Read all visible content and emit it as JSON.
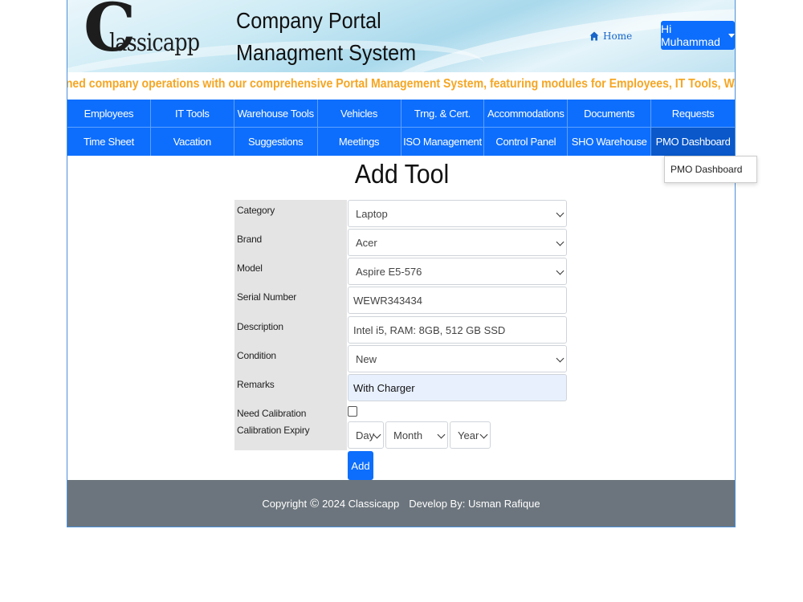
{
  "header": {
    "logo_initial": "C",
    "logo_rest": "lassicapp",
    "title_line1": "Company Portal",
    "title_line2": "Managment System",
    "home_label": "Home",
    "user_label": "Hi Muhammad"
  },
  "marquee": {
    "text": "lined company operations with our comprehensive Portal Management System, featuring modules for Employees, IT Tools, Warehouse Inventory, Vehi"
  },
  "nav": {
    "row1": [
      "Employees",
      "IT Tools",
      "Warehouse Tools",
      "Vehicles",
      "Trng. & Cert.",
      "Accommodations",
      "Documents",
      "Requests"
    ],
    "row2": [
      "Time Sheet",
      "Vacation",
      "Suggestions",
      "Meetings",
      "ISO Management",
      "Control Panel",
      "SHO Warehouse",
      "PMO Dashboard"
    ],
    "dropdown_item": "PMO Dashboard"
  },
  "form": {
    "title": "Add Tool",
    "category": {
      "label": "Category",
      "value": "Laptop"
    },
    "brand": {
      "label": "Brand",
      "value": "Acer"
    },
    "model": {
      "label": "Model",
      "value": "Aspire E5-576"
    },
    "serial": {
      "label": "Serial Number",
      "value": "WEWR343434"
    },
    "description": {
      "label": "Description",
      "value": "Intel i5, RAM: 8GB, 512 GB SSD"
    },
    "condition": {
      "label": "Condition",
      "value": "New"
    },
    "remarks": {
      "label": "Remarks",
      "value": "With Charger"
    },
    "need_calibration": {
      "label": "Need Calibration"
    },
    "calibration_expiry": {
      "label": "Calibration Expiry",
      "day": "Day",
      "month": "Month",
      "year": "Year"
    },
    "submit_label": "Add"
  },
  "footer": {
    "copyright": "Copyright",
    "copyright_symbol": "©",
    "year_company": "2024 Classicapp",
    "developer": "Develop By:  Usman Rafique"
  },
  "colors": {
    "primary": "#0d6efd",
    "marquee": "#f5a623",
    "footer": "#6c757d"
  }
}
